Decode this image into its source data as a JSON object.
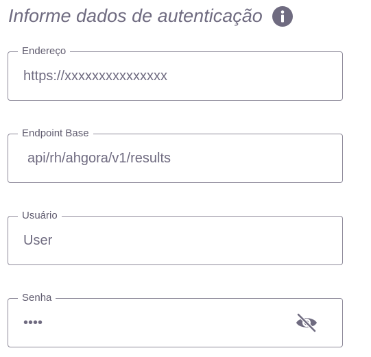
{
  "header": {
    "title": "Informe dados de autenticação",
    "info_icon": "info-icon"
  },
  "fields": [
    {
      "label": "Endereço",
      "value": "https://xxxxxxxxxxxxxxx"
    },
    {
      "label": "Endpoint Base",
      "value": "api/rh/ahgora/v1/results"
    },
    {
      "label": "Usuário",
      "value": "User"
    },
    {
      "label": "Senha",
      "value": "....",
      "toggle_icon": "eye-off-icon"
    }
  ],
  "colors": {
    "text": "#6f6b80",
    "border": "#8c8898",
    "icon": "#6f6b80"
  }
}
